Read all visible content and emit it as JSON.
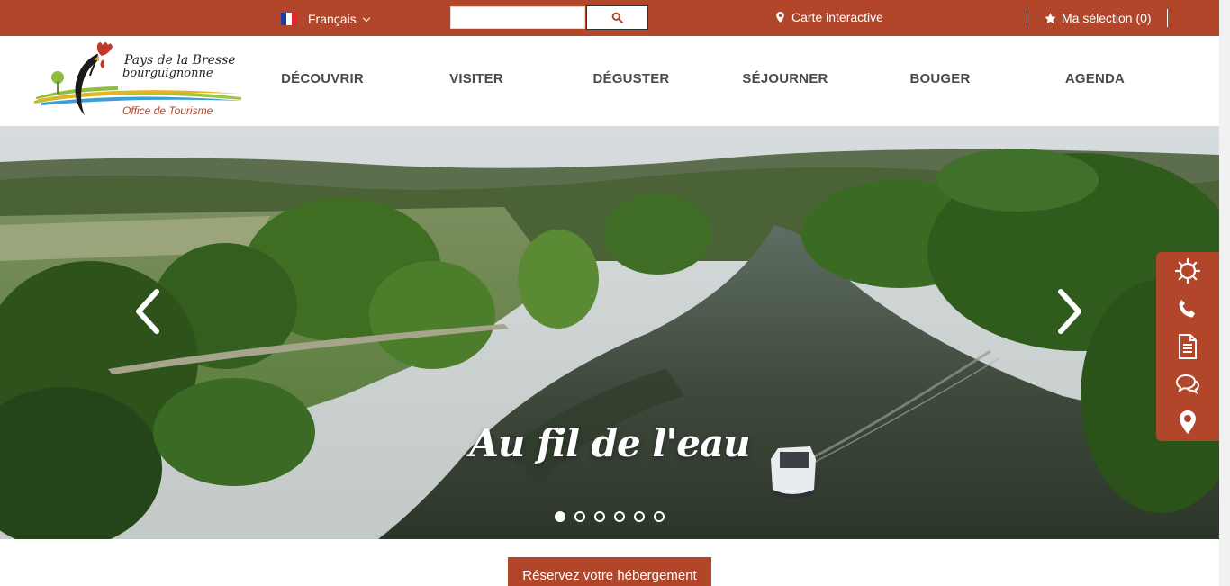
{
  "colors": {
    "brand": "#b2462a",
    "nav_text": "#4a4a4a",
    "white": "#ffffff"
  },
  "topbar": {
    "language": {
      "label": "Français",
      "flag": "fr-flag-icon"
    },
    "search": {
      "placeholder": "",
      "button_icon": "search-icon"
    },
    "map_link": {
      "label": "Carte interactive",
      "icon": "map-pin-icon"
    },
    "selection": {
      "label": "Ma sélection (0)",
      "icon": "star-icon"
    }
  },
  "logo": {
    "line1": "Pays de la Bresse",
    "line2": "bourguignonne",
    "line3": "Office de Tourisme"
  },
  "nav": {
    "items": [
      {
        "label": "DÉCOUVRIR"
      },
      {
        "label": "VISITER"
      },
      {
        "label": "DÉGUSTER"
      },
      {
        "label": "SÉJOURNER"
      },
      {
        "label": "BOUGER"
      },
      {
        "label": "AGENDA"
      }
    ]
  },
  "hero": {
    "caption": "Au fil de l'eau",
    "slides_count": 6,
    "active_slide": 1
  },
  "side_tools": [
    {
      "icon": "weather-sun-icon"
    },
    {
      "icon": "phone-icon"
    },
    {
      "icon": "document-icon"
    },
    {
      "icon": "chat-icon"
    },
    {
      "icon": "location-pin-icon"
    }
  ],
  "cta": {
    "label": "Réservez votre hébergement"
  }
}
